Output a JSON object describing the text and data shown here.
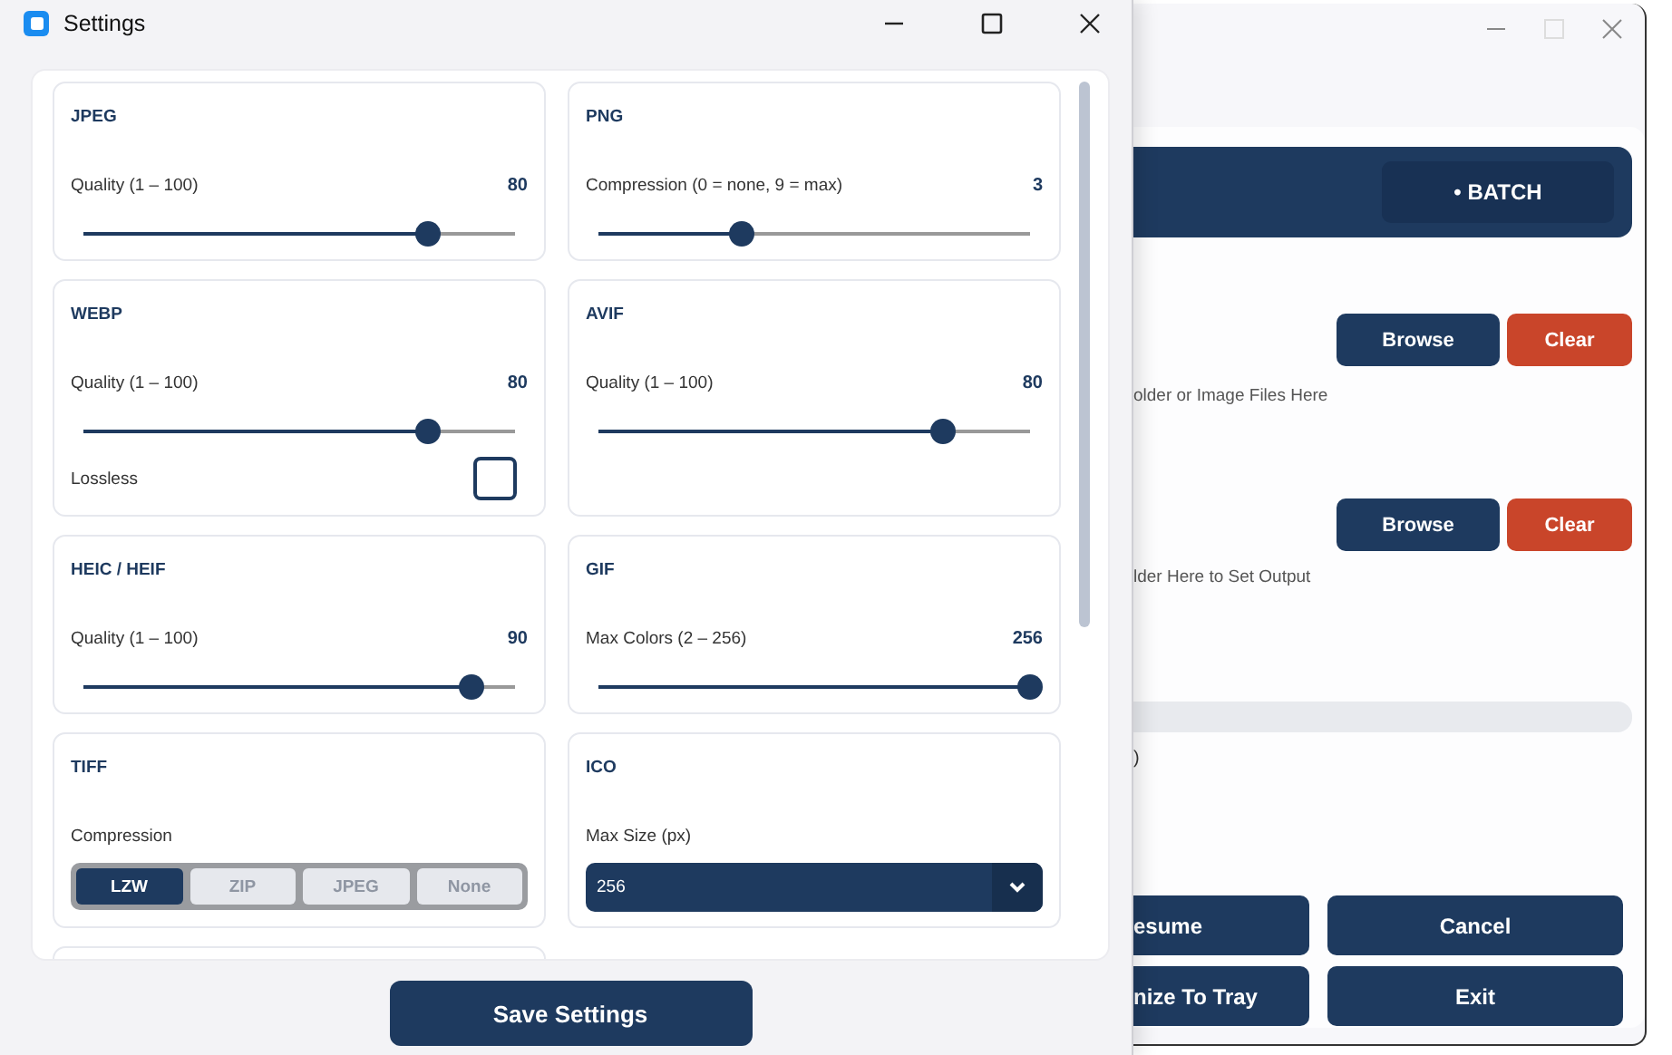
{
  "settings_window": {
    "title": "Settings",
    "cards": [
      {
        "title": "JPEG",
        "kind": "slider",
        "label": "Quality  (1 – 100)",
        "value": "80",
        "level": 0.8
      },
      {
        "title": "PNG",
        "kind": "slider",
        "label": "Compression  (0 = none, 9 = max)",
        "value": "3",
        "level": 0.33
      },
      {
        "title": "WEBP",
        "kind": "slider_checkbox",
        "label": "Quality  (1 – 100)",
        "value": "80",
        "level": 0.8,
        "checkbox_label": "Lossless",
        "checked": false
      },
      {
        "title": "AVIF",
        "kind": "slider",
        "label": "Quality  (1 – 100)",
        "value": "80",
        "level": 0.8
      },
      {
        "title": "HEIC / HEIF",
        "kind": "slider",
        "label": "Quality  (1 – 100)",
        "value": "90",
        "level": 0.9
      },
      {
        "title": "GIF",
        "kind": "slider",
        "label": "Max Colors  (2 – 256)",
        "value": "256",
        "level": 1.0
      },
      {
        "title": "TIFF",
        "kind": "segmented",
        "label": "Compression",
        "options": [
          {
            "label": "LZW",
            "selected": true
          },
          {
            "label": "ZIP",
            "selected": false
          },
          {
            "label": "JPEG",
            "selected": false
          },
          {
            "label": "None",
            "selected": false
          }
        ]
      },
      {
        "title": "ICO",
        "kind": "dropdown",
        "label": "Max Size (px)",
        "value": "256"
      }
    ],
    "save_button": "Save Settings"
  },
  "main_window": {
    "mode_badge": "• BATCH",
    "input": {
      "browse": "Browse",
      "clear": "Clear",
      "hint": "older or Image Files Here"
    },
    "output": {
      "browse": "Browse",
      "clear": "Clear",
      "hint": "lder Here to Set Output"
    },
    "progress": {
      "level": 0
    },
    "status": ")",
    "buttons": [
      "esume",
      "Cancel",
      "nize To Tray",
      "Exit"
    ]
  }
}
